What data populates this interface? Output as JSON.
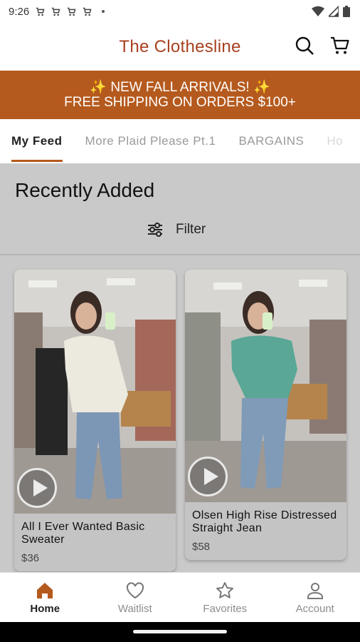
{
  "status_bar": {
    "time": "9:26",
    "notification_icons": [
      "cart-icon",
      "cart-icon",
      "cart-icon",
      "cart-icon"
    ]
  },
  "header": {
    "title": "The Clothesline",
    "brand_color": "#a8401f",
    "icons": [
      "search-icon",
      "cart-icon"
    ]
  },
  "promo": {
    "line1": "✨ NEW FALL ARRIVALS! ✨",
    "line2": "FREE SHIPPING ON ORDERS $100+",
    "color": "#b55a1e"
  },
  "tabs": [
    {
      "label": "My Feed",
      "active": true
    },
    {
      "label": "More Plaid Please Pt.1",
      "active": false
    },
    {
      "label": "BARGAINS",
      "active": false
    },
    {
      "label": "Ho",
      "active": false
    }
  ],
  "section": {
    "heading": "Recently Added",
    "filter_label": "Filter"
  },
  "products": [
    {
      "name": "All I Ever Wanted Basic Sweater",
      "price": "$36",
      "top_color": "#ece9df"
    },
    {
      "name": "Olsen High Rise Distressed Straight Jean",
      "price": "$58",
      "top_color": "#5aa796"
    }
  ],
  "bottom_nav": [
    {
      "label": "Home",
      "icon": "home-icon",
      "active": true
    },
    {
      "label": "Waitlist",
      "icon": "heart-icon",
      "active": false
    },
    {
      "label": "Favorites",
      "icon": "star-icon",
      "active": false
    },
    {
      "label": "Account",
      "icon": "person-icon",
      "active": false
    }
  ]
}
